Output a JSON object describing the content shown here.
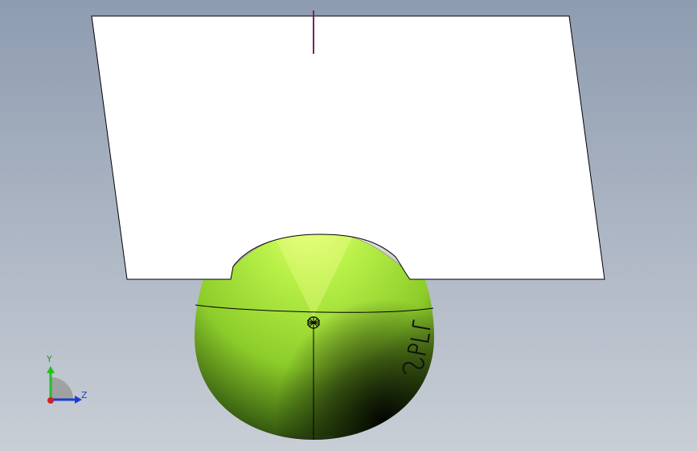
{
  "viewport": {
    "background_top": "#8e9cb0",
    "background_bottom": "#c9ced6"
  },
  "model": {
    "plane_color": "#ffffff",
    "egg_top_color": "#e8e8e8",
    "egg_body_color": "#a6e43a",
    "egg_highlight_color": "#e9ff7a",
    "egg_shadow_color": "#0f1a05",
    "edge_color": "#000000",
    "axis_marker_color": "#9b1f6a",
    "engraved_text_color": "#111111"
  },
  "triad": {
    "y_label": "Y",
    "z_label": "Z",
    "y_color": "#22c022",
    "z_color": "#1e3ccf",
    "x_color": "#d0202a",
    "y_label_color": "#1a9a1a",
    "z_label_color": "#1e3ccf"
  }
}
